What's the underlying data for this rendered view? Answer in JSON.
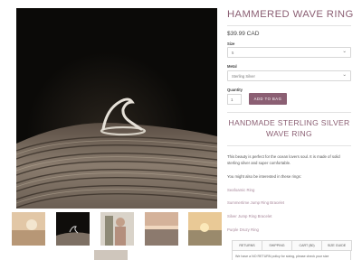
{
  "product": {
    "title": "HAMMERED WAVE RING",
    "price": "$39.99 CAD",
    "size_label": "Size",
    "size_value": "5",
    "metal_label": "Metal",
    "metal_value": "Sterling Silver",
    "quantity_label": "Quantity",
    "quantity_value": "1",
    "add_to_bag": "ADD TO BAG"
  },
  "details": {
    "subtitle": "HANDMADE STERLING SILVER WAVE RING",
    "description": "This beauty is perfect for the ocean lovers soul. It is made of solid sterling silver and super comfortable.",
    "related_intro": "You might also be interested in these rings:",
    "related_links": [
      "Seafoamic Ring",
      "Summertime Jump Ring Bracelet",
      "Silver Jump Ring Bracelet",
      "Purple Druzy Ring"
    ]
  },
  "tabs": [
    "RETURNS",
    "SHIPPING",
    "CART ($0)",
    "SIZE GUIDE"
  ],
  "tab_content": "We have a NO RETURN policy for sizing, please check your size",
  "icons": {
    "select_chevron": "chevron-down-icon"
  }
}
